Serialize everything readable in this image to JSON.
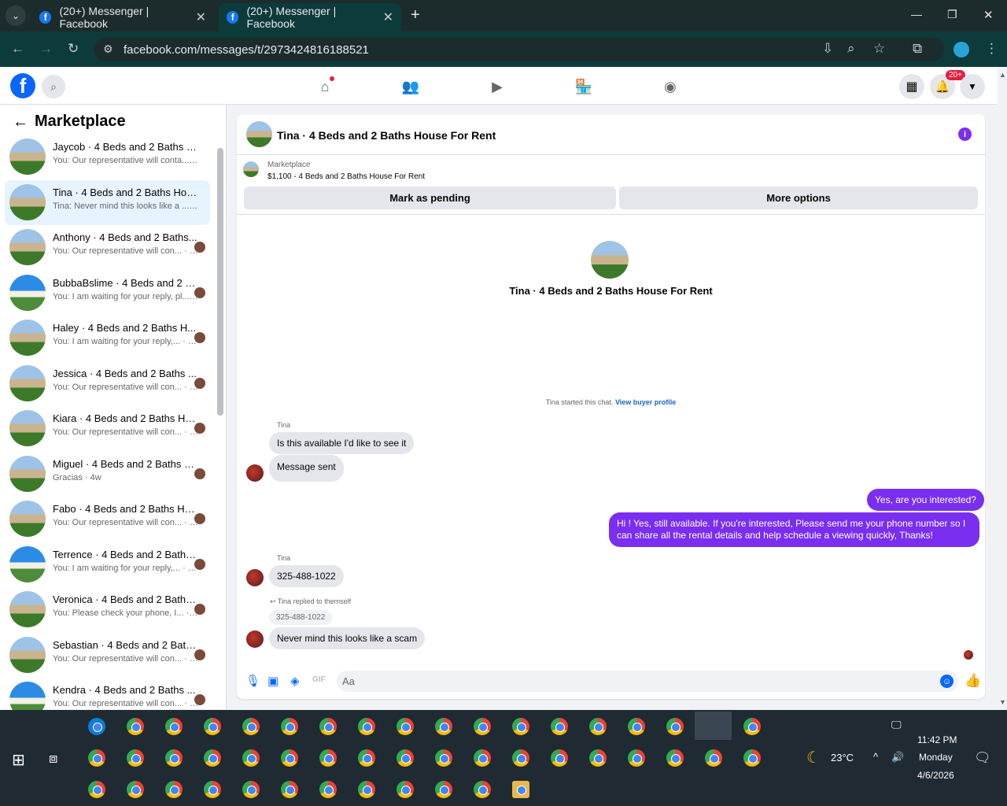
{
  "browser": {
    "tabs": [
      {
        "title": "(20+) Messenger | Facebook"
      },
      {
        "title": "(20+) Messenger | Facebook"
      }
    ],
    "new_tab": "+",
    "url": "facebook.com/messages/t/2973424816188521",
    "window_controls": [
      "—",
      "❐",
      "✕"
    ]
  },
  "fb": {
    "logo": "f",
    "notification_badge": "20+"
  },
  "sidebar": {
    "title": "Marketplace",
    "conversations": [
      {
        "name": "Jaycob · 4 Beds and 2 Baths Ho...",
        "preview": "You: Our representative will conta... · 1m",
        "avatar": "house"
      },
      {
        "name": "Tina · 4 Beds and 2 Baths House...",
        "preview": "Tina: Never mind this looks like a ... · 1m",
        "avatar": "house",
        "active": true
      },
      {
        "name": "Anthony · 4 Beds and 2 Baths...",
        "preview": "You: Our representative will con... · 2w",
        "avatar": "house"
      },
      {
        "name": "BubbaBslime · 4 Beds and 2 Bat...",
        "preview": "You: I am waiting for your reply, pl... · 2w",
        "avatar": "blue"
      },
      {
        "name": "Haley · 4 Beds and 2 Baths H...",
        "preview": "You: I am waiting for your reply,... · 2w",
        "avatar": "house"
      },
      {
        "name": "Jessica · 4 Beds and 2 Baths ...",
        "preview": "You: Our representative will con... · 4w",
        "avatar": "house"
      },
      {
        "name": "Kiara · 4 Beds and 2 Baths Ho...",
        "preview": "You: Our representative will con... · 4w",
        "avatar": "house"
      },
      {
        "name": "Miguel · 4 Beds and 2 Baths Ho...",
        "preview": "Gracias · 4w",
        "avatar": "house"
      },
      {
        "name": "Fabo · 4 Beds and 2 Baths Ho...",
        "preview": "You: Our representative will con... · 4w",
        "avatar": "house"
      },
      {
        "name": "Terrence · 4 Beds and 2 Baths...",
        "preview": "You: I am waiting for your reply,... · 5w",
        "avatar": "blue"
      },
      {
        "name": "Veronica · 4 Beds and 2 Baths...",
        "preview": "You: Please check your phone, I... · 5w",
        "avatar": "house"
      },
      {
        "name": "Sebastian · 4 Beds and 2 Bath...",
        "preview": "You: Our representative will con... · 5w",
        "avatar": "house"
      },
      {
        "name": "Kendra · 4 Beds and 2 Baths ...",
        "preview": "You: Our representative will con... · 6w",
        "avatar": "blue"
      }
    ]
  },
  "chat": {
    "header_title": "Tina · 4 Beds and 2 Baths House For Rent",
    "listing": {
      "label": "Marketplace",
      "title": "$1,100 - 4 Beds and 2 Baths House For Rent"
    },
    "mark_pending": "Mark as pending",
    "more_options": "More options",
    "intro_title": "Tina · 4 Beds and 2 Baths House For Rent",
    "started_text": "Tina started this chat.",
    "view_profile": "View buyer profile",
    "sender1": "Tina",
    "msg1": "Is this available I'd like to see it",
    "msg2": "Message sent",
    "my_msg1": "Yes, are you interested?",
    "my_msg2_line1": "Hi ! Yes, still available. If you're interested, Please send me your phone number so I",
    "my_msg2_line2": "can share all the rental details and help schedule a viewing quickly, Thanks!",
    "sender2": "Tina",
    "msg3": "325-488-1022",
    "reply_label": "Tina replied to themself",
    "quoted": "325-488-1022",
    "msg4": "Never mind this looks like a scam",
    "input_placeholder": "Aa"
  },
  "taskbar": {
    "weather": "23°C",
    "time": "11:42 PM",
    "day": "Monday",
    "date": "4/6/2026"
  },
  "colors": {
    "accent": "#7a2ef0",
    "fb_blue": "#0866ff",
    "link": "#1b64c8"
  }
}
